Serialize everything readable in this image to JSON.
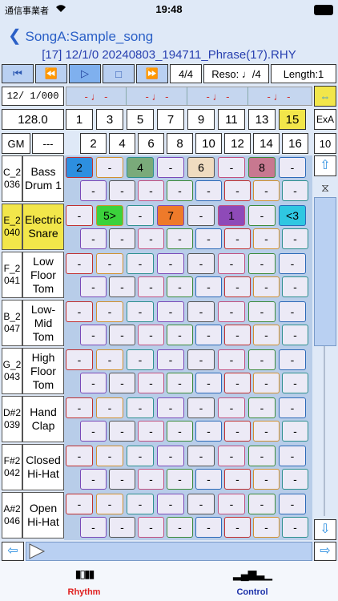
{
  "status": {
    "carrier": "通信事業者",
    "time": "19:48"
  },
  "nav": {
    "back_title": "SongA:Sample_song",
    "subtitle": "[17] 12/1/0 20240803_194711_Phrase(17).RHY"
  },
  "toolbar": {
    "time_sig": "4/4",
    "reso": "Reso: ♩/4",
    "length": "Length:1"
  },
  "position": "12/ 1/000",
  "tempo": "128.0",
  "gm": "GM",
  "dashes": "---",
  "measure_marks": [
    "- ♩ -",
    "- ♩ -",
    "- ♩ -",
    "- ♩ -"
  ],
  "odd_steps": [
    "1",
    "3",
    "5",
    "7",
    "9",
    "11",
    "13",
    "15"
  ],
  "even_steps": [
    "2",
    "4",
    "6",
    "8",
    "10",
    "12",
    "14",
    "16"
  ],
  "exa": "ExA",
  "ten": "10",
  "tracks": [
    {
      "note": "C_2\n036",
      "name": "Bass\nDrum 1"
    },
    {
      "note": "E_2\n040",
      "name": "Electric\nSnare"
    },
    {
      "note": "F_2\n041",
      "name": "Low\nFloor\nTom"
    },
    {
      "note": "B_2\n047",
      "name": "Low-\nMid\nTom"
    },
    {
      "note": "G_2\n043",
      "name": "High\nFloor\nTom"
    },
    {
      "note": "D#2\n039",
      "name": "Hand\nClap"
    },
    {
      "note": "F#2\n042",
      "name": "Closed\nHi-Hat"
    },
    {
      "note": "A#2\n046",
      "name": "Open\nHi-Hat"
    }
  ],
  "row0_top": [
    "2",
    "-",
    "4",
    "-",
    "6",
    "-",
    "8",
    "-"
  ],
  "row1_top": [
    "-",
    "5>",
    "-",
    "7",
    "-",
    "1",
    "-",
    "<3"
  ],
  "dash": "-",
  "colors": {
    "accent": "#2b60c7",
    "highlight": "#f2e64a",
    "cyan": "#2fc7e2",
    "green": "#3bd23b",
    "orange": "#ee7a2a",
    "purple": "#8e4ab8",
    "sand": "#f0dcc0",
    "sage": "#7aaa7a",
    "blue": "#2d8fe0",
    "pink": "#c87890"
  },
  "tabs": [
    {
      "label": "Rhythm"
    },
    {
      "label": "Control"
    }
  ]
}
